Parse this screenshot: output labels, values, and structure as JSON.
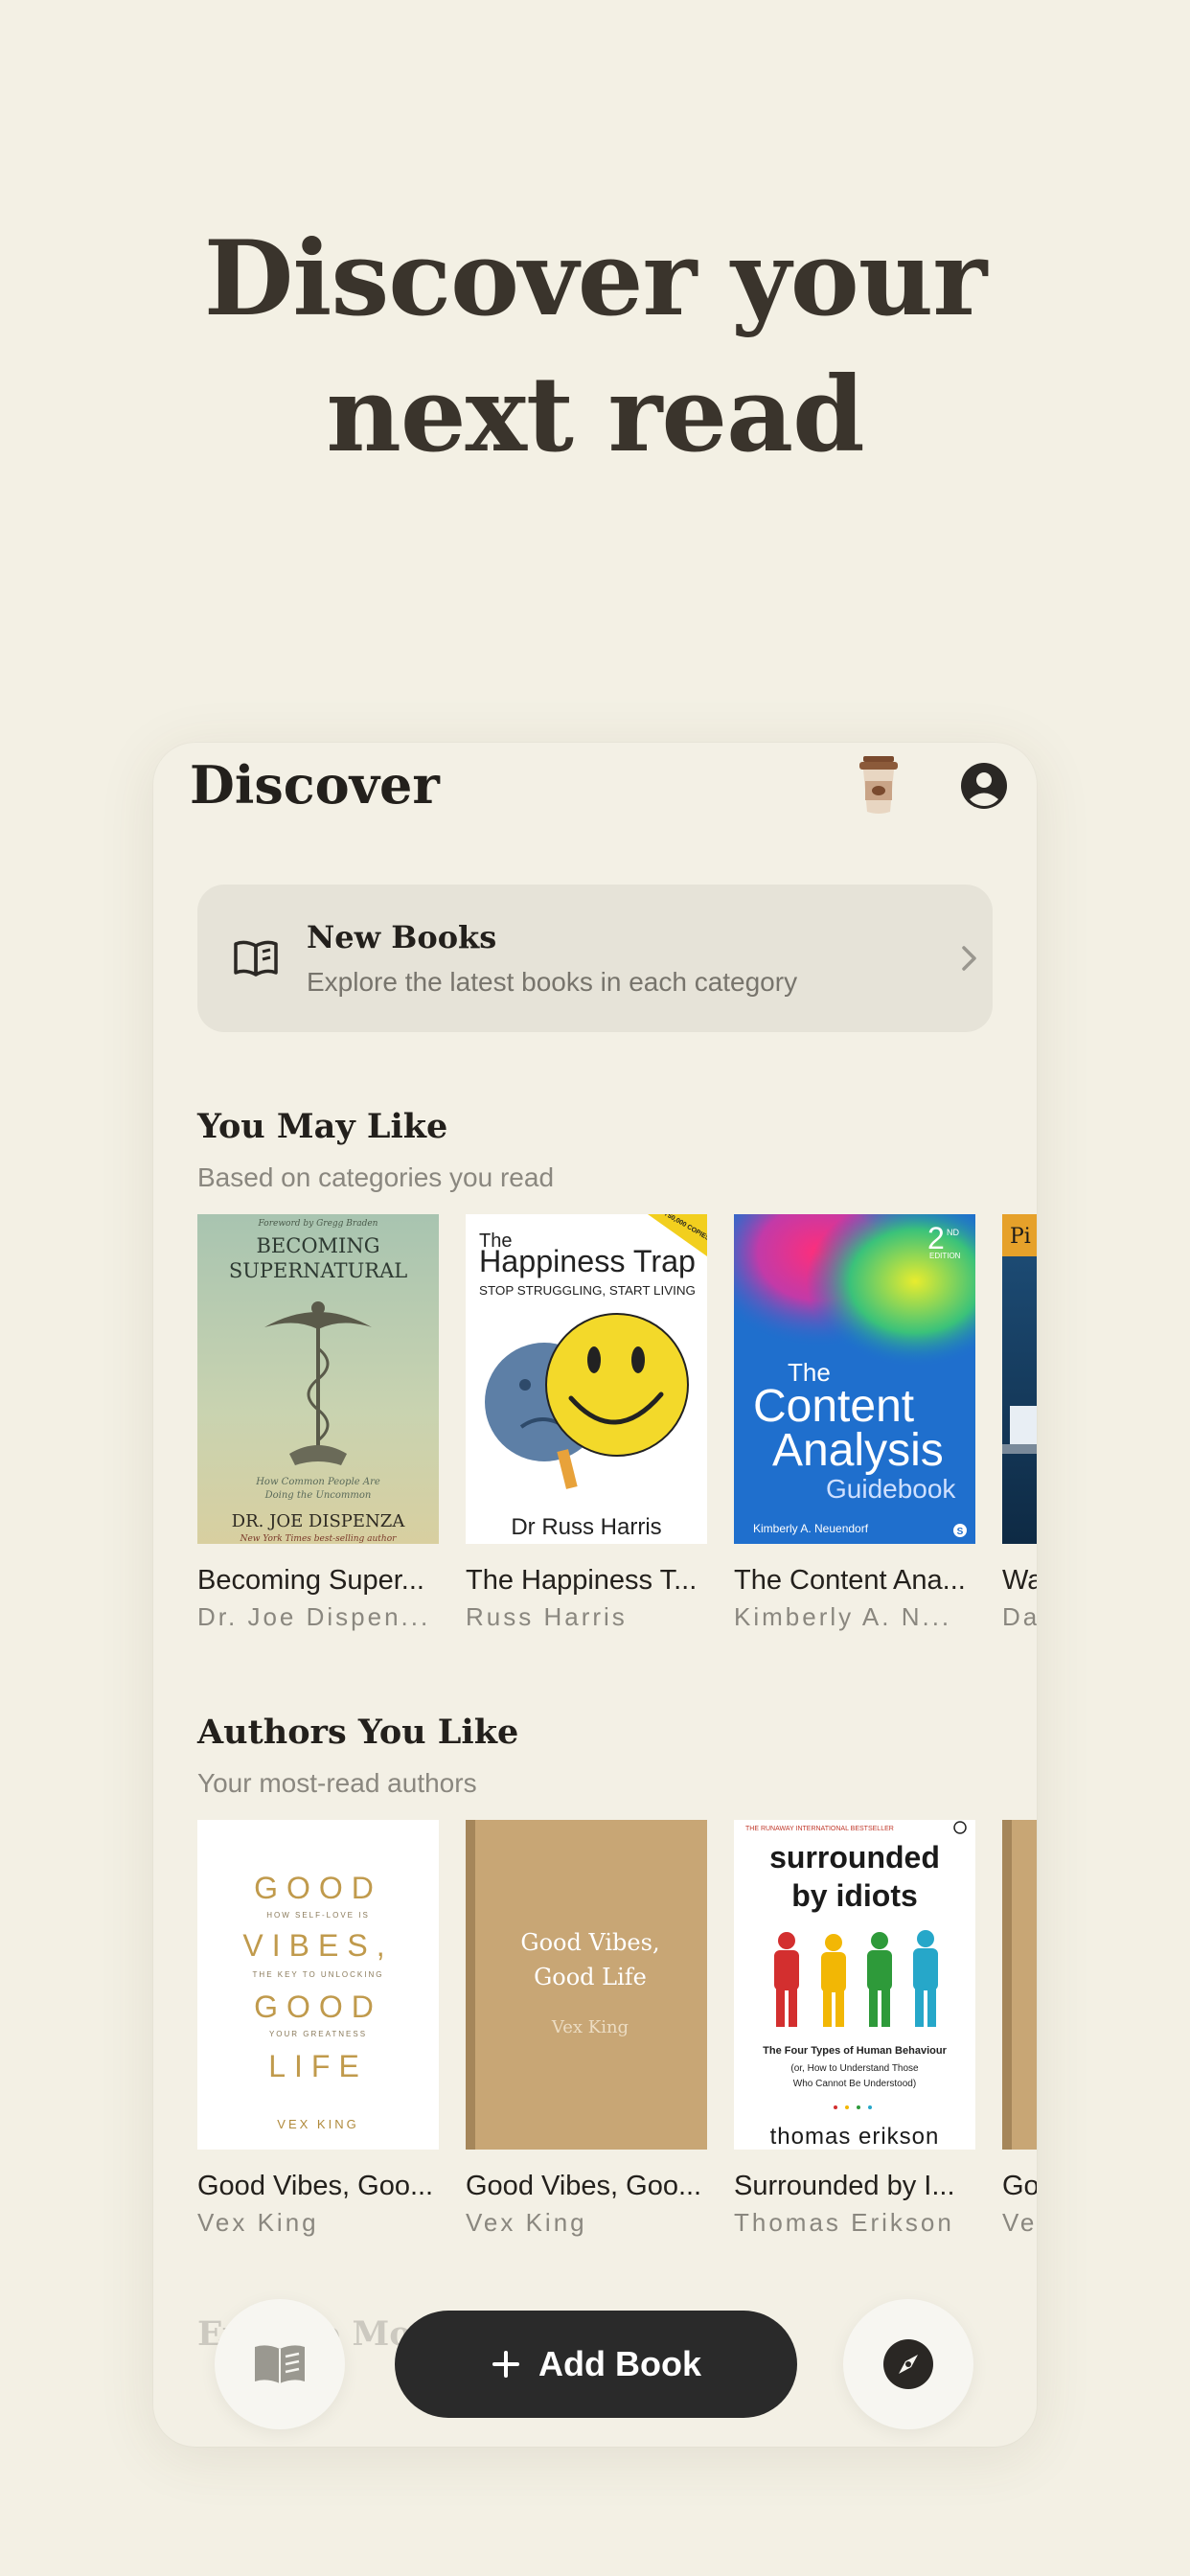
{
  "headline": {
    "line1": "Discover your",
    "line2": "next read"
  },
  "header": {
    "title": "Discover",
    "coffee_icon": "coffee-cup-icon",
    "profile_icon": "account-circle-icon"
  },
  "new_books": {
    "title": "New Books",
    "subtitle": "Explore the latest books in each category",
    "icon": "open-book-icon"
  },
  "you_may_like": {
    "title": "You May Like",
    "subtitle": "Based on categories you read",
    "books": [
      {
        "title": "Becoming Super...",
        "author": "Dr. Joe Dispen...",
        "cover": {
          "top": "Foreword by Gregg Braden",
          "title1": "BECOMING",
          "title2": "SUPERNATURAL",
          "tag1": "How Common People Are",
          "tag2": "Doing the Uncommon",
          "author": "DR. JOE DISPENZA",
          "bottom": "New York Times best-selling author"
        }
      },
      {
        "title": "The Happiness T...",
        "author": "Russ Harris",
        "cover": {
          "the": "The",
          "title": "Happiness Trap",
          "sub": "STOP STRUGGLING, START LIVING",
          "badge": "OVER 750,000 COPIES SOLD",
          "author": "Dr Russ Harris"
        }
      },
      {
        "title": "The Content Ana...",
        "author": "Kimberly A. N...",
        "cover": {
          "edition_num": "2",
          "edition_sup": "ND",
          "edition_word": "EDITION",
          "the": "The",
          "line1": "Content",
          "line2": "Analysis",
          "line3": "Guidebook",
          "author": "Kimberly A. Neuendorf",
          "publisher": "S"
        }
      },
      {
        "title": "Wa",
        "author": "Da",
        "cover": {
          "corner": "Pi"
        }
      }
    ]
  },
  "authors_you_like": {
    "title": "Authors You Like",
    "subtitle": "Your most-read authors",
    "books": [
      {
        "title": "Good Vibes, Goo...",
        "author": "Vex King",
        "cover": {
          "l1": "GOOD",
          "s1": "HOW SELF-LOVE IS",
          "l2": "VIBES,",
          "s2": "THE KEY TO UNLOCKING",
          "l3": "GOOD",
          "s3": "YOUR GREATNESS",
          "l4": "LIFE",
          "author": "VEX KING"
        }
      },
      {
        "title": "Good Vibes, Goo...",
        "author": "Vex King",
        "cover": {
          "t1": "Good Vibes,",
          "t2": "Good Life",
          "author": "Vex King"
        }
      },
      {
        "title": "Surrounded by I...",
        "author": "Thomas Erikson",
        "cover": {
          "top": "THE RUNAWAY INTERNATIONAL BESTSELLER",
          "t1": "surrounded",
          "t2": "by idiots",
          "sub1": "The Four Types of Human Behaviour",
          "sub2": "(or, How to Understand Those",
          "sub3": "Who Cannot Be Understood)",
          "author": "thomas erikson"
        }
      },
      {
        "title": "Go",
        "author": "Ve"
      }
    ]
  },
  "faded_section": {
    "title": "Explore More"
  },
  "bottom_bar": {
    "add_label": "Add Book",
    "library_icon": "book-icon",
    "explore_icon": "compass-icon"
  },
  "colors": {
    "background": "#f3f0e4",
    "card": "#e6e3d8",
    "button_dark": "#2a2a2a",
    "kraft": "#c8a675",
    "gold": "#c0a05a"
  }
}
